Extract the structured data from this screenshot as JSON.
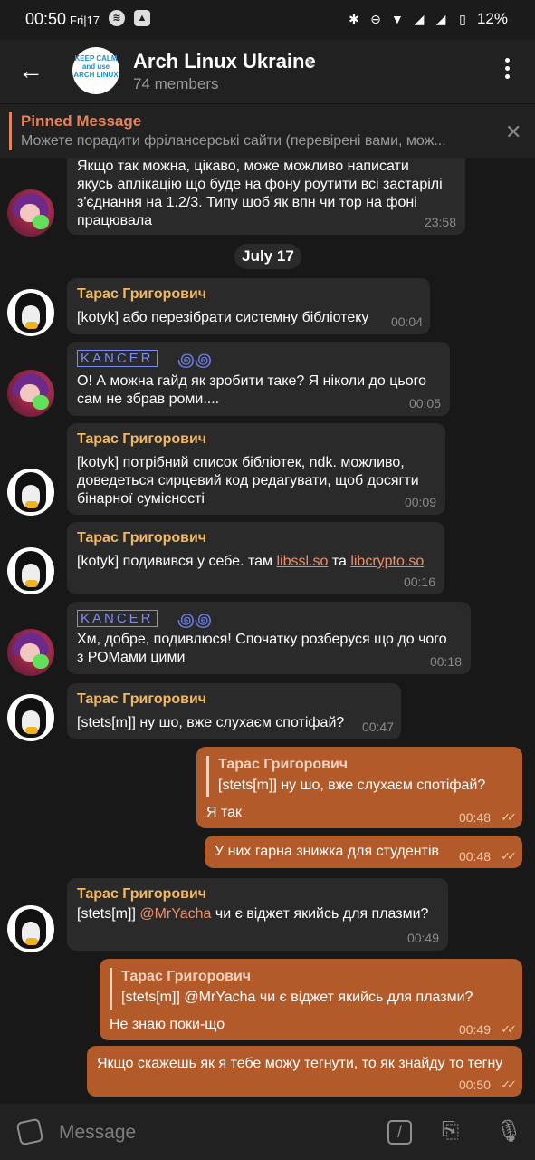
{
  "status_bar": {
    "time": "00:50",
    "date": "Fri|17",
    "battery": "12%"
  },
  "header": {
    "title": "Arch Linux Ukraine",
    "members": "74 members",
    "avatar_text": "KEEP CALM and use ARCH LINUX"
  },
  "pinned": {
    "label": "Pinned Message",
    "text": "Можете порадити фрілансерські сайти (перевірені вами, мож..."
  },
  "date_chip": "July 17",
  "messages": {
    "m0": {
      "line1": "Якщо так можна, цікаво, може можливо написати",
      "line2": "якусь аплікацію що буде на фону роутити всі застарілі",
      "line3": "з'єднання на 1.2/3. Типу шоб як впн чи тор на фоні",
      "line4": "працювала",
      "time": "23:58"
    },
    "m1": {
      "sender": "Тарас Григорович",
      "text": "[kotyk] або перезібрати системну бібліотеку",
      "time": "00:04"
    },
    "m2": {
      "sender": "KANCER",
      "line1": "О! А можна гайд як зробити таке? Я ніколи до цього",
      "line2": "сам не збрав роми....",
      "time": "00:05"
    },
    "m3": {
      "sender": "Тарас Григорович",
      "line1": "[kotyk] потрібний список бібліотек, ndk. можливо,",
      "line2": "доведеться сирцевий код редагувати, щоб досягти",
      "line3": "бінарної сумісності",
      "time": "00:09"
    },
    "m4": {
      "sender": "Тарас Григорович",
      "prefix": "[kotyk] подивився у себе. там ",
      "link1": "libssl.so",
      "mid": " та ",
      "link2": "libcrypto.so",
      "time": "00:16"
    },
    "m5": {
      "sender": "KANCER",
      "line1": "Хм, добре, подивлюся! Спочатку розберуся що до чого",
      "line2": "з РОМами цими",
      "time": "00:18"
    },
    "m6": {
      "sender": "Тарас Григорович",
      "text": "[stets[m]] ну шо, вже слухаєм спотіфай?",
      "time": "00:47"
    },
    "m7": {
      "quote_sender": "Тарас Григорович",
      "quote_text": "[stets[m]] ну шо, вже слухаєм спотіфай?",
      "text": "Я так",
      "time": "00:48"
    },
    "m8": {
      "text": "У них гарна знижка для студентів",
      "time": "00:48"
    },
    "m9": {
      "sender": "Тарас Григорович",
      "prefix": "[stets[m]] ",
      "mention": "@MrYacha",
      "suffix": " чи є віджет якийсь для плазми?",
      "time": "00:49"
    },
    "m10": {
      "quote_sender": "Тарас Григорович",
      "quote_text": "[stets[m]] @MrYacha чи є віджет якийсь для плазми?",
      "text": "Не знаю поки-що",
      "time": "00:49"
    },
    "m11": {
      "text": "Якщо скажешь як я тебе можу тегнути, то як знайду то тегну",
      "time": "00:50"
    }
  },
  "composer": {
    "placeholder": "Message"
  }
}
